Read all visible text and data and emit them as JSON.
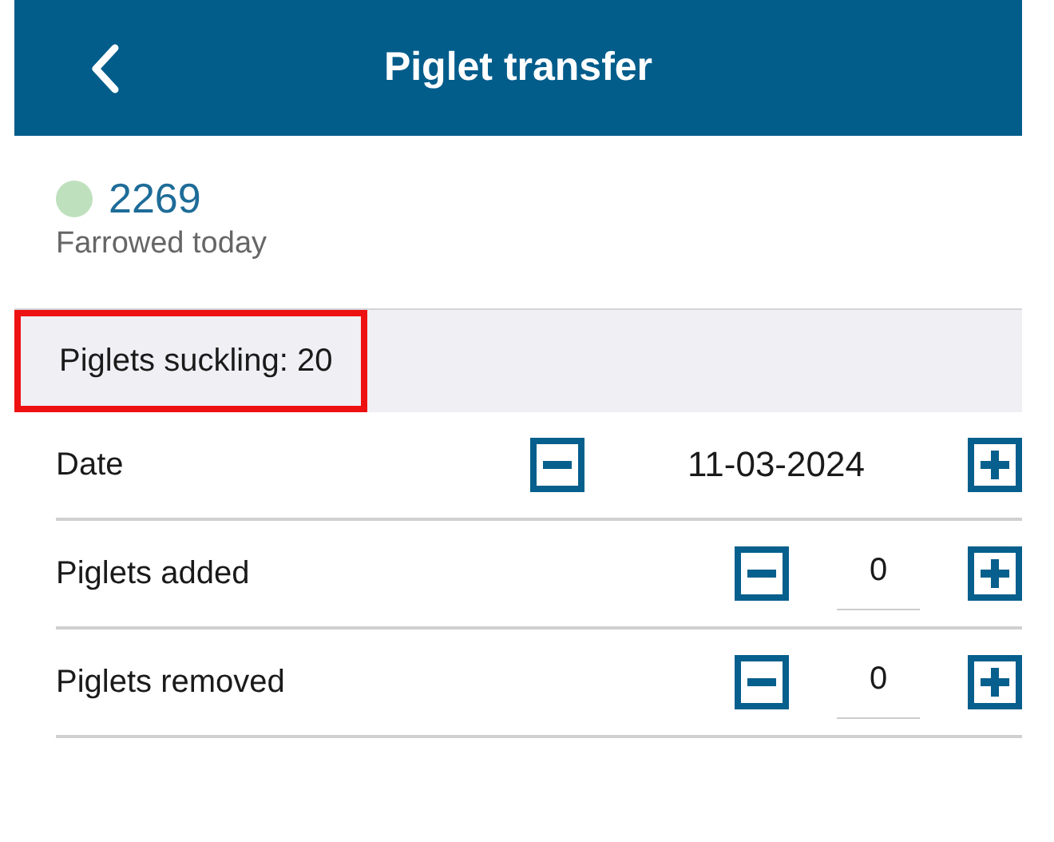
{
  "header": {
    "title": "Piglet transfer"
  },
  "sow": {
    "number": "2269",
    "color": "#bfe0bd",
    "status": "Farrowed today"
  },
  "summary": {
    "text": "Piglets suckling: 20",
    "highlighted": true
  },
  "rows": [
    {
      "kind": "date",
      "label": "Date",
      "value": "11-03-2024"
    },
    {
      "kind": "counter",
      "label": "Piglets added",
      "value": "0"
    },
    {
      "kind": "counter",
      "label": "Piglets removed",
      "value": "0"
    }
  ]
}
